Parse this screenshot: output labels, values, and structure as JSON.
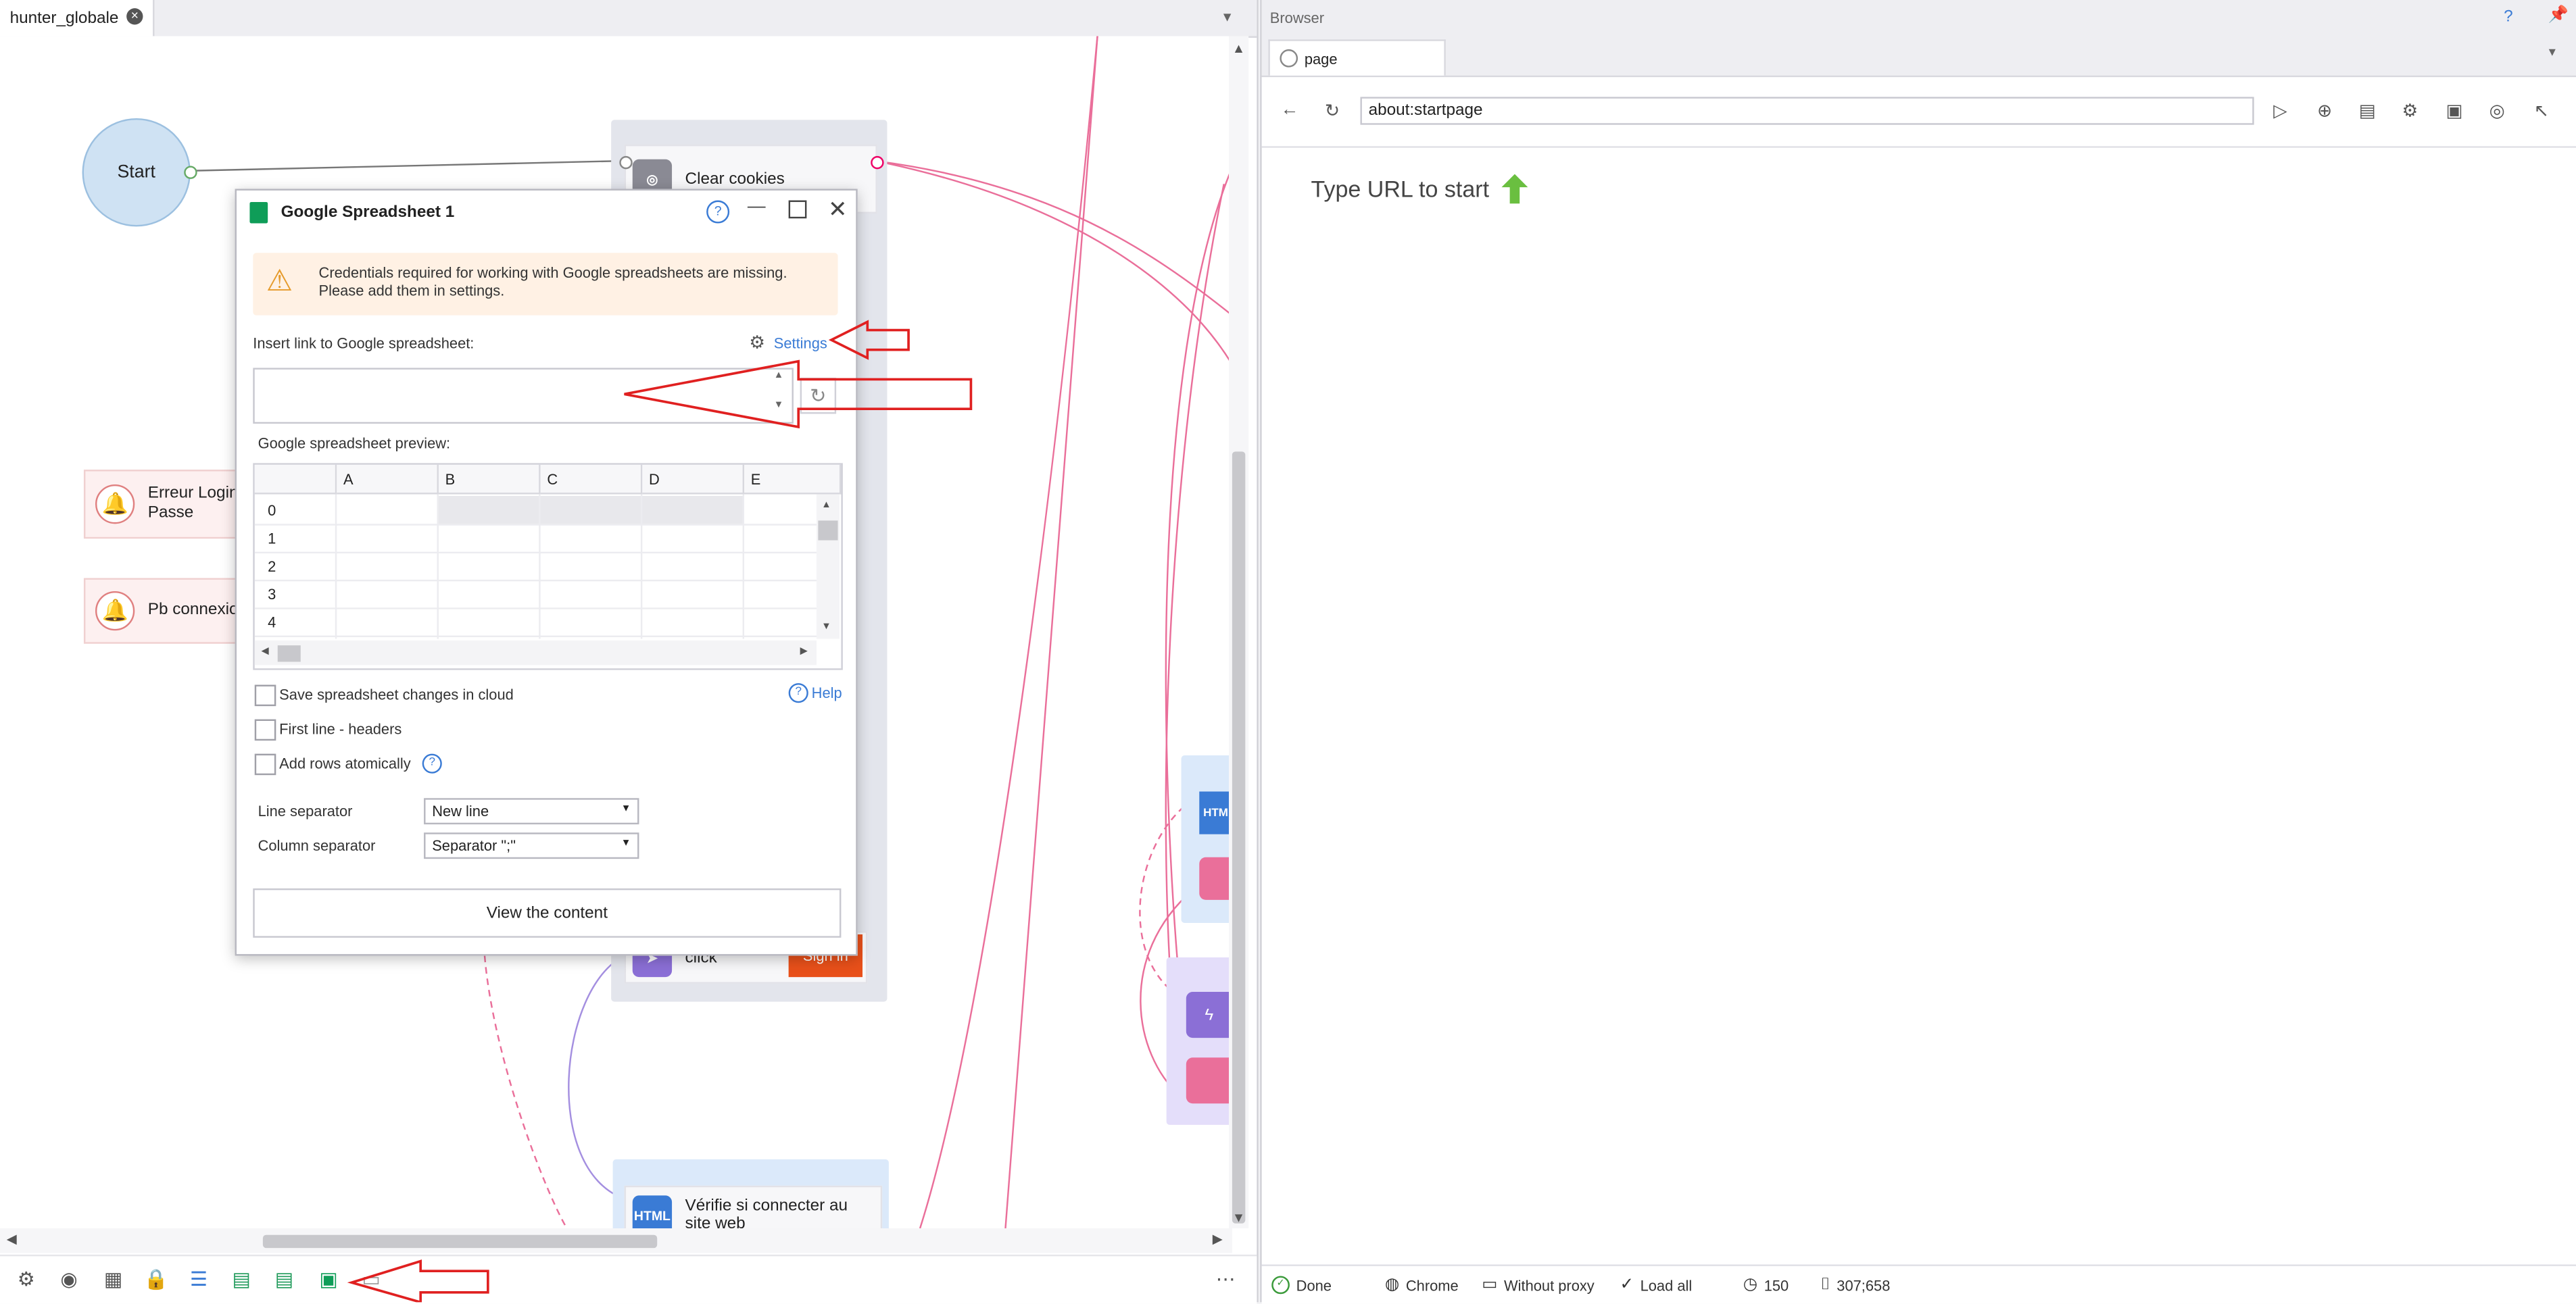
{
  "editor": {
    "tab_label": "hunter_globale",
    "nodes": {
      "start": "Start",
      "clear_cookies": "Clear cookies",
      "erreur_login": "Erreur Login",
      "erreur_login_line2": "Passe",
      "pb_connexion": "Pb connexio",
      "click": "click",
      "sign_in": "Sign in",
      "html_badge": "HTML",
      "verifie": "Vérifie si connecter au",
      "verifie_line2": "site web",
      "htm_badge": "HTM"
    }
  },
  "dialog": {
    "title": "Google Spreadsheet 1",
    "warning": "Credentials required for working with Google spreadsheets are missing. Please add them in  settings.",
    "insert_label": "Insert link to Google spreadsheet:",
    "settings_link": "Settings",
    "link_value": "",
    "preview_label": "Google spreadsheet preview:",
    "columns": [
      "A",
      "B",
      "C",
      "D",
      "E"
    ],
    "rows": [
      "0",
      "1",
      "2",
      "3",
      "4"
    ],
    "save_changes": "Save spreadsheet changes in cloud",
    "help": "Help",
    "first_line": "First line - headers",
    "add_rows": "Add rows atomically",
    "line_sep_label": "Line separator",
    "line_sep_value": "New line",
    "col_sep_label": "Column separator",
    "col_sep_value": "Separator \";\"",
    "view_button": "View the content"
  },
  "browser": {
    "panel_title": "Browser",
    "help_q": "?",
    "tab_label": "page",
    "url": "about:startpage",
    "start_text": "Type URL to start",
    "status": {
      "done": "Done",
      "engine": "Chrome",
      "proxy": "Without proxy",
      "load": "Load all",
      "timeout": "150",
      "coords": "307;658"
    }
  },
  "colors": {
    "accent": "#3a7bd5",
    "warning_bg": "#fff1e4",
    "arrow": "#e02020",
    "sign_in": "#e8501a",
    "html_icon": "#3a7bd5"
  }
}
